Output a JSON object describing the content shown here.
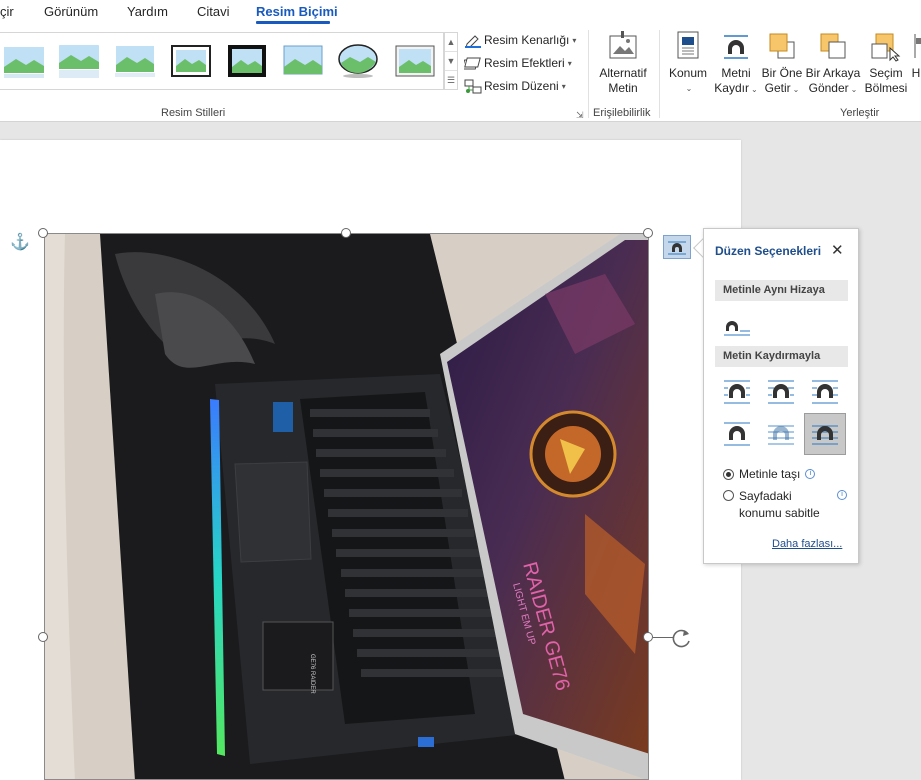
{
  "tabs": [
    {
      "label": "çir"
    },
    {
      "label": "Görünüm"
    },
    {
      "label": "Yardım"
    },
    {
      "label": "Citavi"
    },
    {
      "label": "Resim Biçimi",
      "active": true
    }
  ],
  "ribbon": {
    "picture_styles_group": "Resim Stilleri",
    "border_label": "Resim Kenarlığı",
    "effects_label": "Resim Efektleri",
    "layout_label": "Resim Düzeni",
    "accessibility_group": "Erişilebilirlik",
    "alt_text_line1": "Alternatif",
    "alt_text_line2": "Metin",
    "arrange_group": "Yerleştir",
    "position_line1": "Konum",
    "wrap_line1": "Metni",
    "wrap_line2": "Kaydır",
    "forward_line1": "Bir Öne",
    "forward_line2": "Getir",
    "backward_line1": "Bir Arkaya",
    "backward_line2": "Gönder",
    "selection_line1": "Seçim",
    "selection_line2": "Bölmesi",
    "cut_off_label": "H"
  },
  "layout_pane": {
    "title": "Düzen Seçenekleri",
    "section_inline": "Metinle Aynı Hizaya",
    "section_wrap": "Metin Kaydırmayla",
    "radio_move": "Metinle taşı",
    "radio_fix_line1": "Sayfadaki",
    "radio_fix_line2": "konumu sabitle",
    "more_link": "Daha fazlası..."
  },
  "photo_text": {
    "laptop_lid": "RAIDER GE76",
    "lid_sub": "LIGHT EM UP",
    "sticker_brand": "GE76 RAIDER"
  },
  "colors": {
    "accent": "#185abd",
    "pane_title": "#1f4e8c",
    "anchor": "#2b79c2"
  },
  "icons": [
    "anchor-icon",
    "rotate-icon",
    "close-icon",
    "info-icon"
  ]
}
